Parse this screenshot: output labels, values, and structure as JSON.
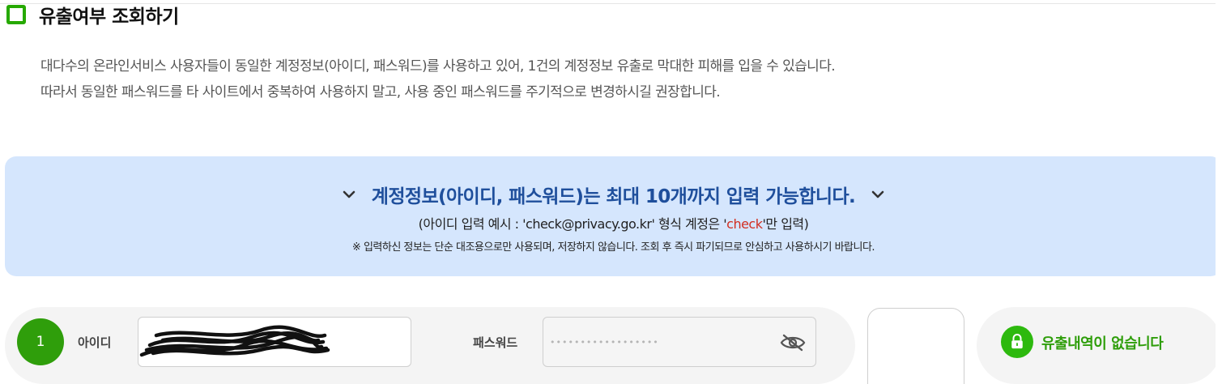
{
  "section": {
    "title": "유출여부 조회하기"
  },
  "description": {
    "line1": "대다수의 온라인서비스 사용자들이 동일한 계정정보(아이디, 패스워드)를 사용하고 있어, 1건의 계정정보 유출로 막대한 피해를 입을 수 있습니다.",
    "line2": "따라서 동일한 패스워드를 타 사이트에서 중복하여 사용하지 말고, 사용 중인 패스워드를 주기적으로 변경하시길 권장합니다."
  },
  "banner": {
    "headline": "계정정보(아이디, 패스워드)는 최대 10개까지 입력 가능합니다.",
    "example_prefix": "(아이디 입력 예시 : 'check@privacy.go.kr' 형식 계정은 '",
    "example_highlight": "check",
    "example_suffix": "'만 입력)",
    "notice": "※ 입력하신 정보는 단순 대조용으로만 사용되며, 저장하지 않습니다. 조회 후 즉시 파기되므로 안심하고 사용하시기 바랍니다.",
    "colors": {
      "background": "#d5e6fd",
      "headline": "#1f4f9c",
      "highlight": "#d22e20"
    }
  },
  "entry": {
    "number": "1",
    "id_label": "아이디",
    "password_label": "패스워드",
    "password_value": "••••••••••••••••••"
  },
  "result": {
    "text": "유출내역이 없습니다",
    "color": "#2f9e0b"
  },
  "icons": {
    "checkbox": "checkbox-icon",
    "chevron": "chevron-down-icon",
    "eye": "eye-slash-icon",
    "lock": "lock-icon"
  }
}
